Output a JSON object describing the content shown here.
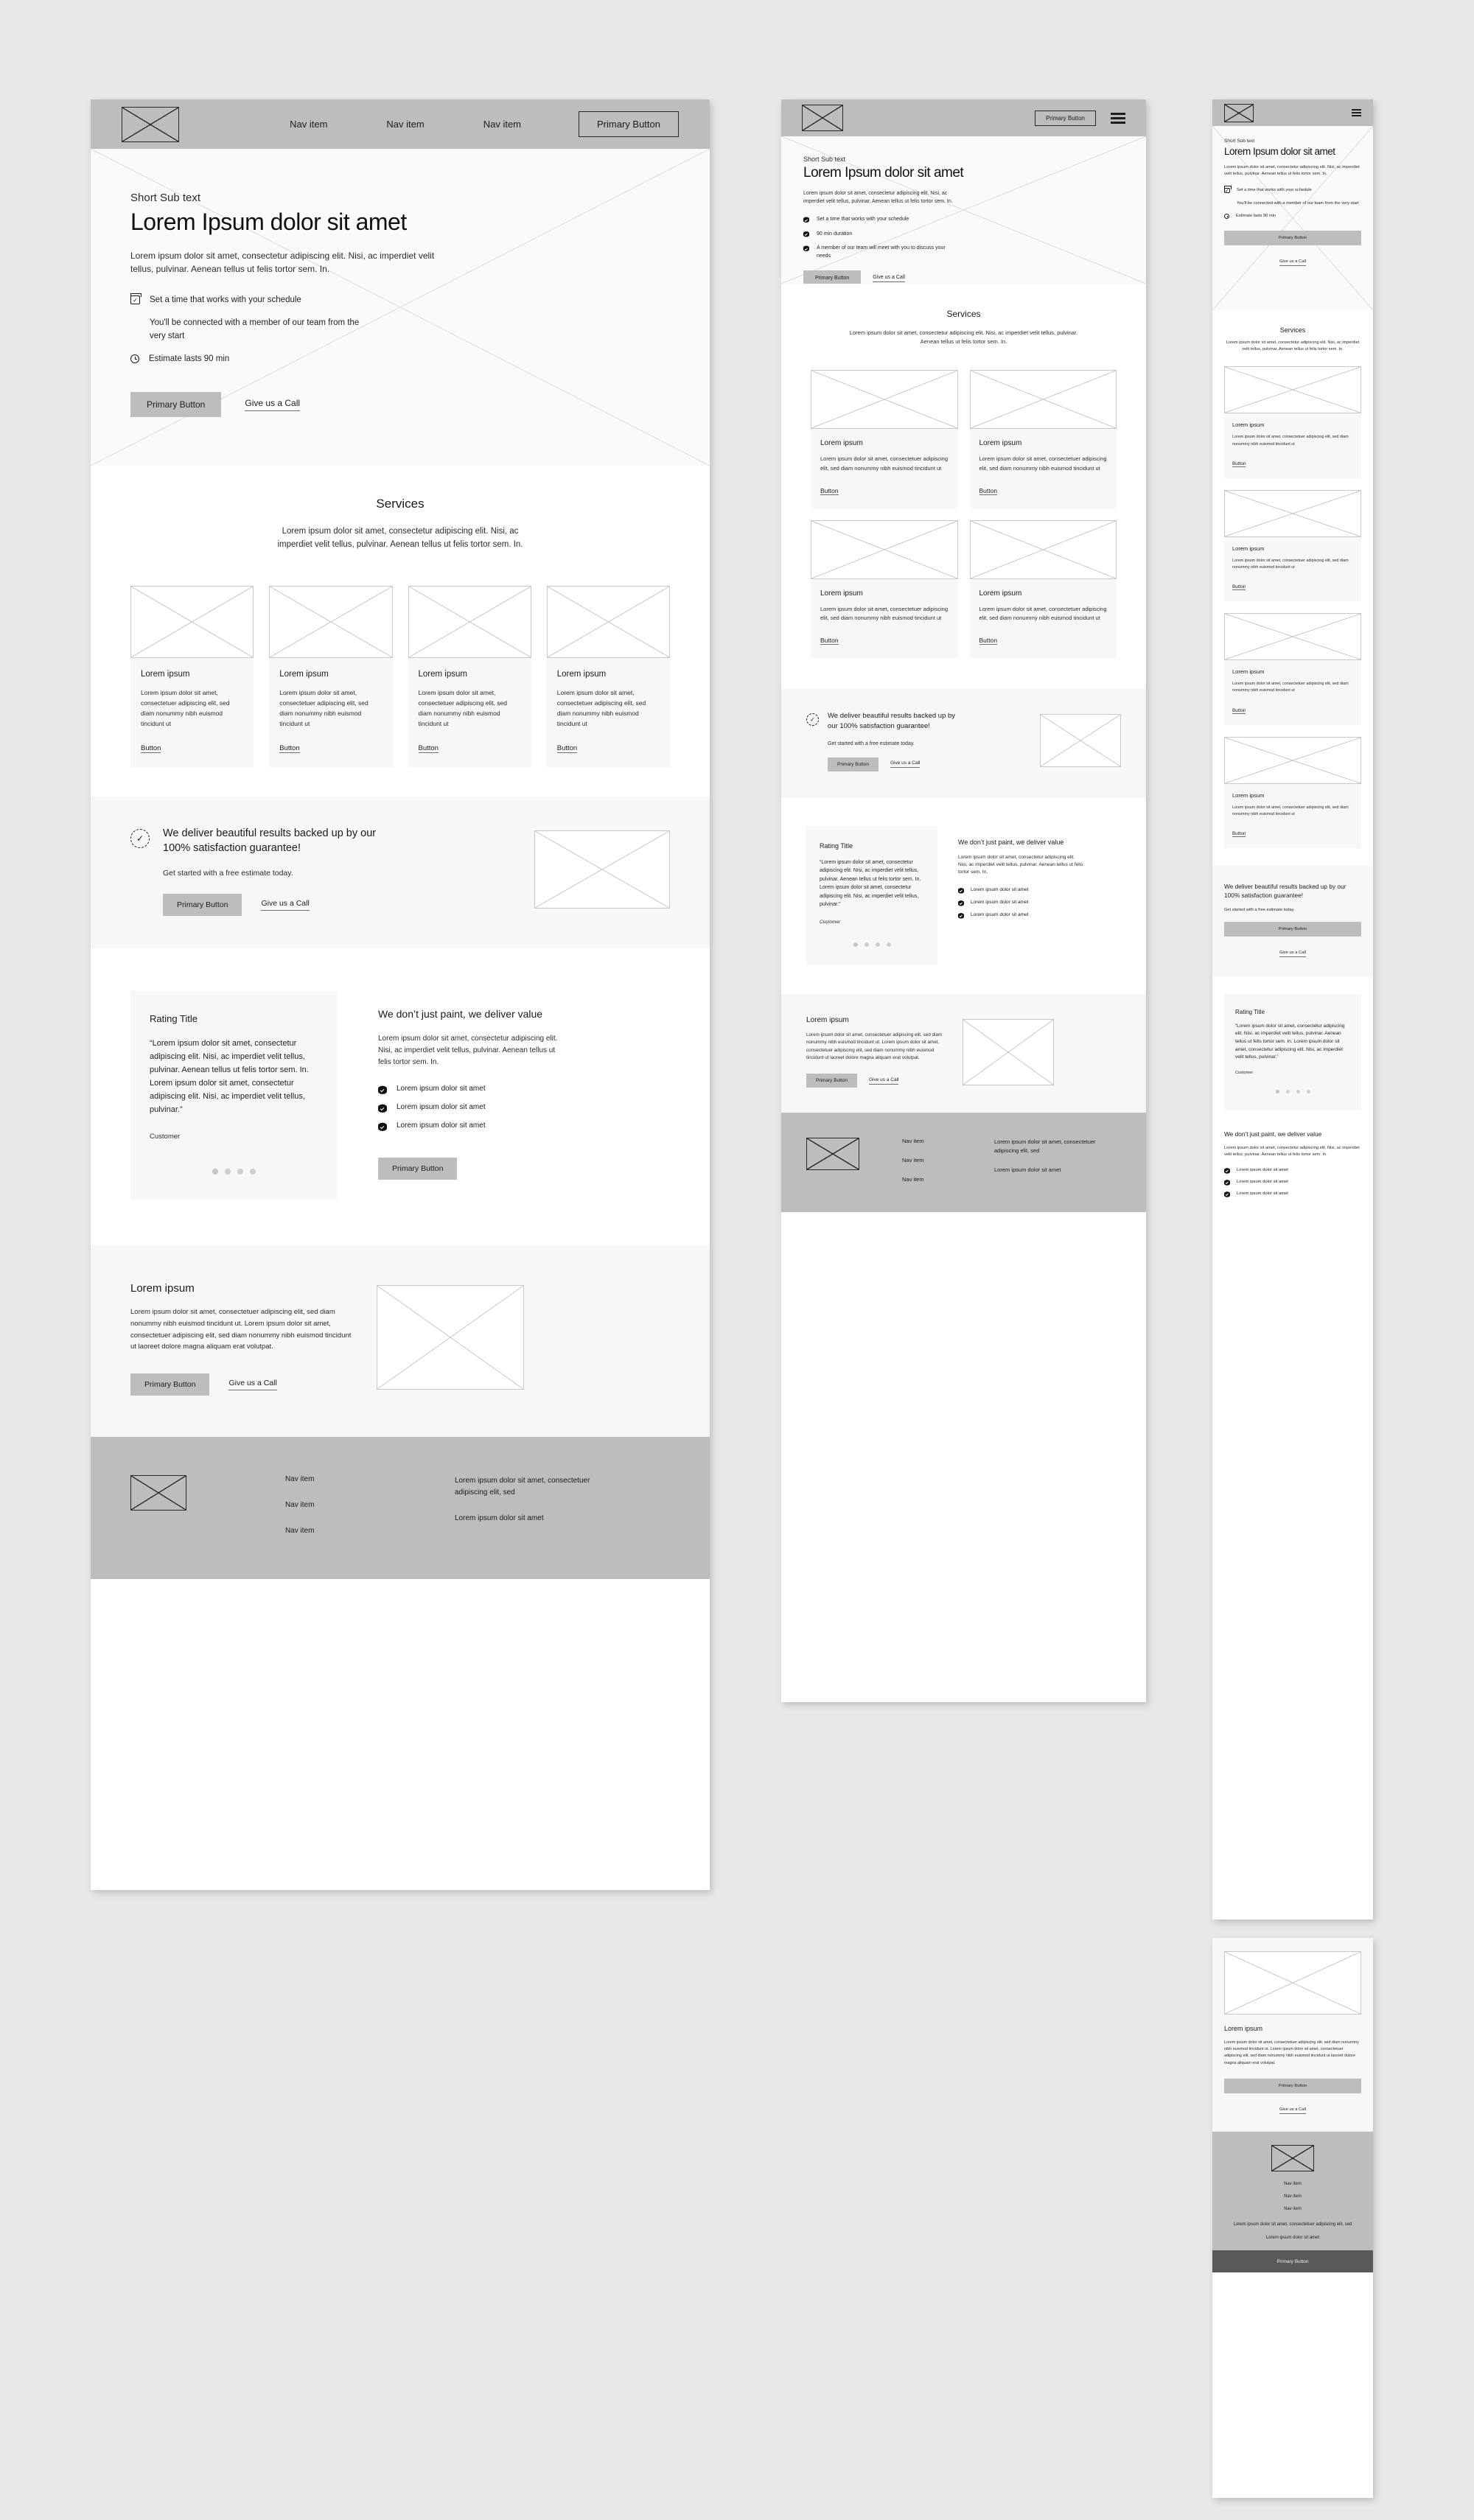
{
  "brand": {
    "accent": "#bdbdbd",
    "page_bg": "#e8e8e8",
    "frame_bg": "#ffffff",
    "section_grey": "#f7f7f7",
    "dark_button": "#595959"
  },
  "nav": {
    "items": [
      "Nav item",
      "Nav item",
      "Nav item"
    ],
    "primary_button": "Primary Button",
    "logo_icon": "image-placeholder-icon",
    "menu_icon": "hamburger-menu-icon"
  },
  "hero": {
    "eyebrow": "Short Sub text",
    "title": "Lorem Ipsum dolor sit amet",
    "paragraph": "Lorem ipsum dolor sit amet, consectetur adipiscing elit. Nisi, ac imperdiet velit tellus, pulvinar. Aenean tellus ut felis tortor sem. In.",
    "features_desktop": [
      {
        "icon": "calendar-check-icon",
        "text": "Set a time that works with your schedule"
      },
      {
        "icon": "handshake-icon",
        "text": "You'll be connected with a member of our team from the very start"
      },
      {
        "icon": "clock-icon",
        "text": "Estimate lasts 90 min"
      }
    ],
    "features_tablet": [
      {
        "icon": "check-badge-icon",
        "text": "Set a time that works with your schedule"
      },
      {
        "icon": "check-badge-icon",
        "text": "90 min duration"
      },
      {
        "icon": "check-badge-icon",
        "text": "A member of our team will meet with you to discuss your needs"
      }
    ],
    "primary_button": "Primary Button",
    "secondary_link": "Give us a Call"
  },
  "services": {
    "title": "Services",
    "paragraph": "Lorem ipsum dolor sit amet, consectetur adipiscing elit. Nisi, ac imperdiet velit tellus, pulvinar. Aenean tellus ut felis tortor sem. In.",
    "card": {
      "title": "Lorem ipsum",
      "body": "Lorem ipsum dolor sit amet, consectetuer adipiscing elit, sed diam nonummy nibh euismod tincidunt ut",
      "button": "Button",
      "image_icon": "image-placeholder-icon"
    },
    "card_count_desktop": 4,
    "card_count_tablet": 4,
    "card_count_mobile": 4
  },
  "guarantee": {
    "icon": "satisfaction-seal-icon",
    "title": "We deliver beautiful results backed up by our 100% satisfaction guarantee!",
    "subtitle": "Get started with a free estimate today.",
    "primary_button": "Primary Button",
    "secondary_link": "Give us a Call",
    "image_icon": "image-placeholder-icon"
  },
  "rating": {
    "title": "Rating Title",
    "quote": "“Lorem ipsum dolor sit amet, consectetur adipiscing elit. Nisi, ac imperdiet velit tellus, pulvinar. Aenean tellus ut felis tortor sem. In. Lorem ipsum dolor sit amet, consectetur adipiscing elit. Nisi, ac imperdiet velit tellus, pulvinar.”",
    "author": "Customer",
    "dot_count": 4,
    "active_dot": 0
  },
  "value": {
    "title": "We don’t just paint, we deliver value",
    "paragraph": "Lorem ipsum dolor sit amet, consectetur adipiscing elit. Nisi, ac imperdiet velit tellus, pulvinar. Aenean tellus ut felis tortor sem. In.",
    "bullets": [
      "Lorem ipsum dolor sit amet",
      "Lorem ipsum dolor sit amet",
      "Lorem ipsum dolor sit amet"
    ],
    "bullet_icon": "check-badge-icon",
    "primary_button": "Primary Button"
  },
  "closing": {
    "title": "Lorem ipsum",
    "paragraph": "Lorem ipsum dolor sit amet, consectetuer adipiscing elit, sed diam nonummy nibh euismod tincidunt ut. Lorem ipsum dolor sit amet, consectetuer adipiscing elit, sed diam nonummy nibh euismod tincidunt ut laoreet dolore magna aliquam erat volutpat.",
    "primary_button": "Primary Button",
    "secondary_link": "Give us a Call",
    "image_icon": "image-placeholder-icon"
  },
  "footer": {
    "logo_icon": "image-placeholder-icon",
    "nav_items": [
      "Nav item",
      "Nav item",
      "Nav item"
    ],
    "address_line": "Lorem ipsum dolor sit amet, consectetuer adipiscing elit, sed",
    "contact_line": "Lorem ipsum dolor sit amet",
    "sticky_button": "Primary Button"
  }
}
